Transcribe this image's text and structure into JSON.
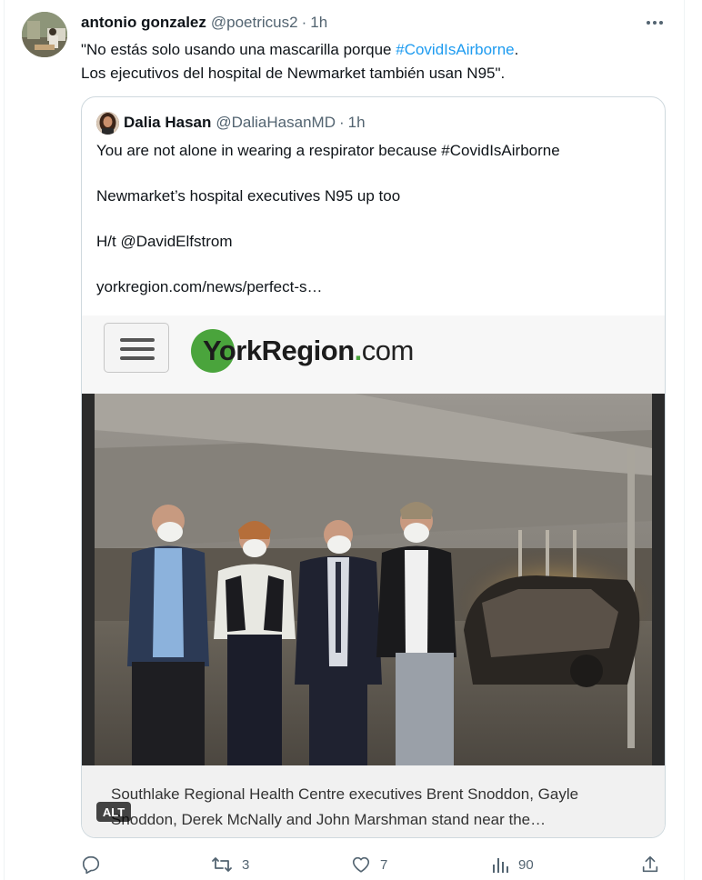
{
  "tweet": {
    "author_name": "antonio gonzalez",
    "author_handle": "@poetricus2",
    "separator": "·",
    "time": "1h",
    "text_line1_before": "\"No estás solo usando una mascarilla porque ",
    "text_line1_hashtag": "#CovidIsAirborne",
    "text_line1_after": ".",
    "text_line2": "Los ejecutivos del hospital de Newmarket también usan N95\".",
    "more_icon": "more-horizontal-icon"
  },
  "quoted": {
    "author_name": "Dalia Hasan",
    "author_handle": "@DaliaHasanMD",
    "separator": "·",
    "time": "1h",
    "paragraphs": [
      "You are not alone in wearing a respirator because #CovidIsAirborne",
      "Newmarket’s hospital executives N95 up too",
      "H/t @DavidElfstrom",
      "yorkregion.com/news/perfect-s…"
    ],
    "site": {
      "logo_text_main": "YorkRegion",
      "logo_text_dot": ".",
      "logo_text_tld": "com",
      "menu_icon": "hamburger-menu-icon",
      "brand_color": "#4aa43c"
    },
    "caption_line1": "Southlake Regional Health Centre executives Brent Snoddon, Gayle",
    "caption_line2": "Snoddon, Derek McNally and John Marshman stand near the…",
    "alt_badge": "ALT"
  },
  "actions": {
    "reply": {
      "icon": "reply-icon",
      "count": ""
    },
    "retweet": {
      "icon": "retweet-icon",
      "count": "3"
    },
    "like": {
      "icon": "heart-icon",
      "count": "7"
    },
    "views": {
      "icon": "views-chart-icon",
      "count": "90"
    },
    "share": {
      "icon": "share-icon",
      "count": ""
    }
  },
  "colors": {
    "link": "#1d9bf0",
    "secondary_text": "#536471",
    "border": "#cfd9de"
  }
}
